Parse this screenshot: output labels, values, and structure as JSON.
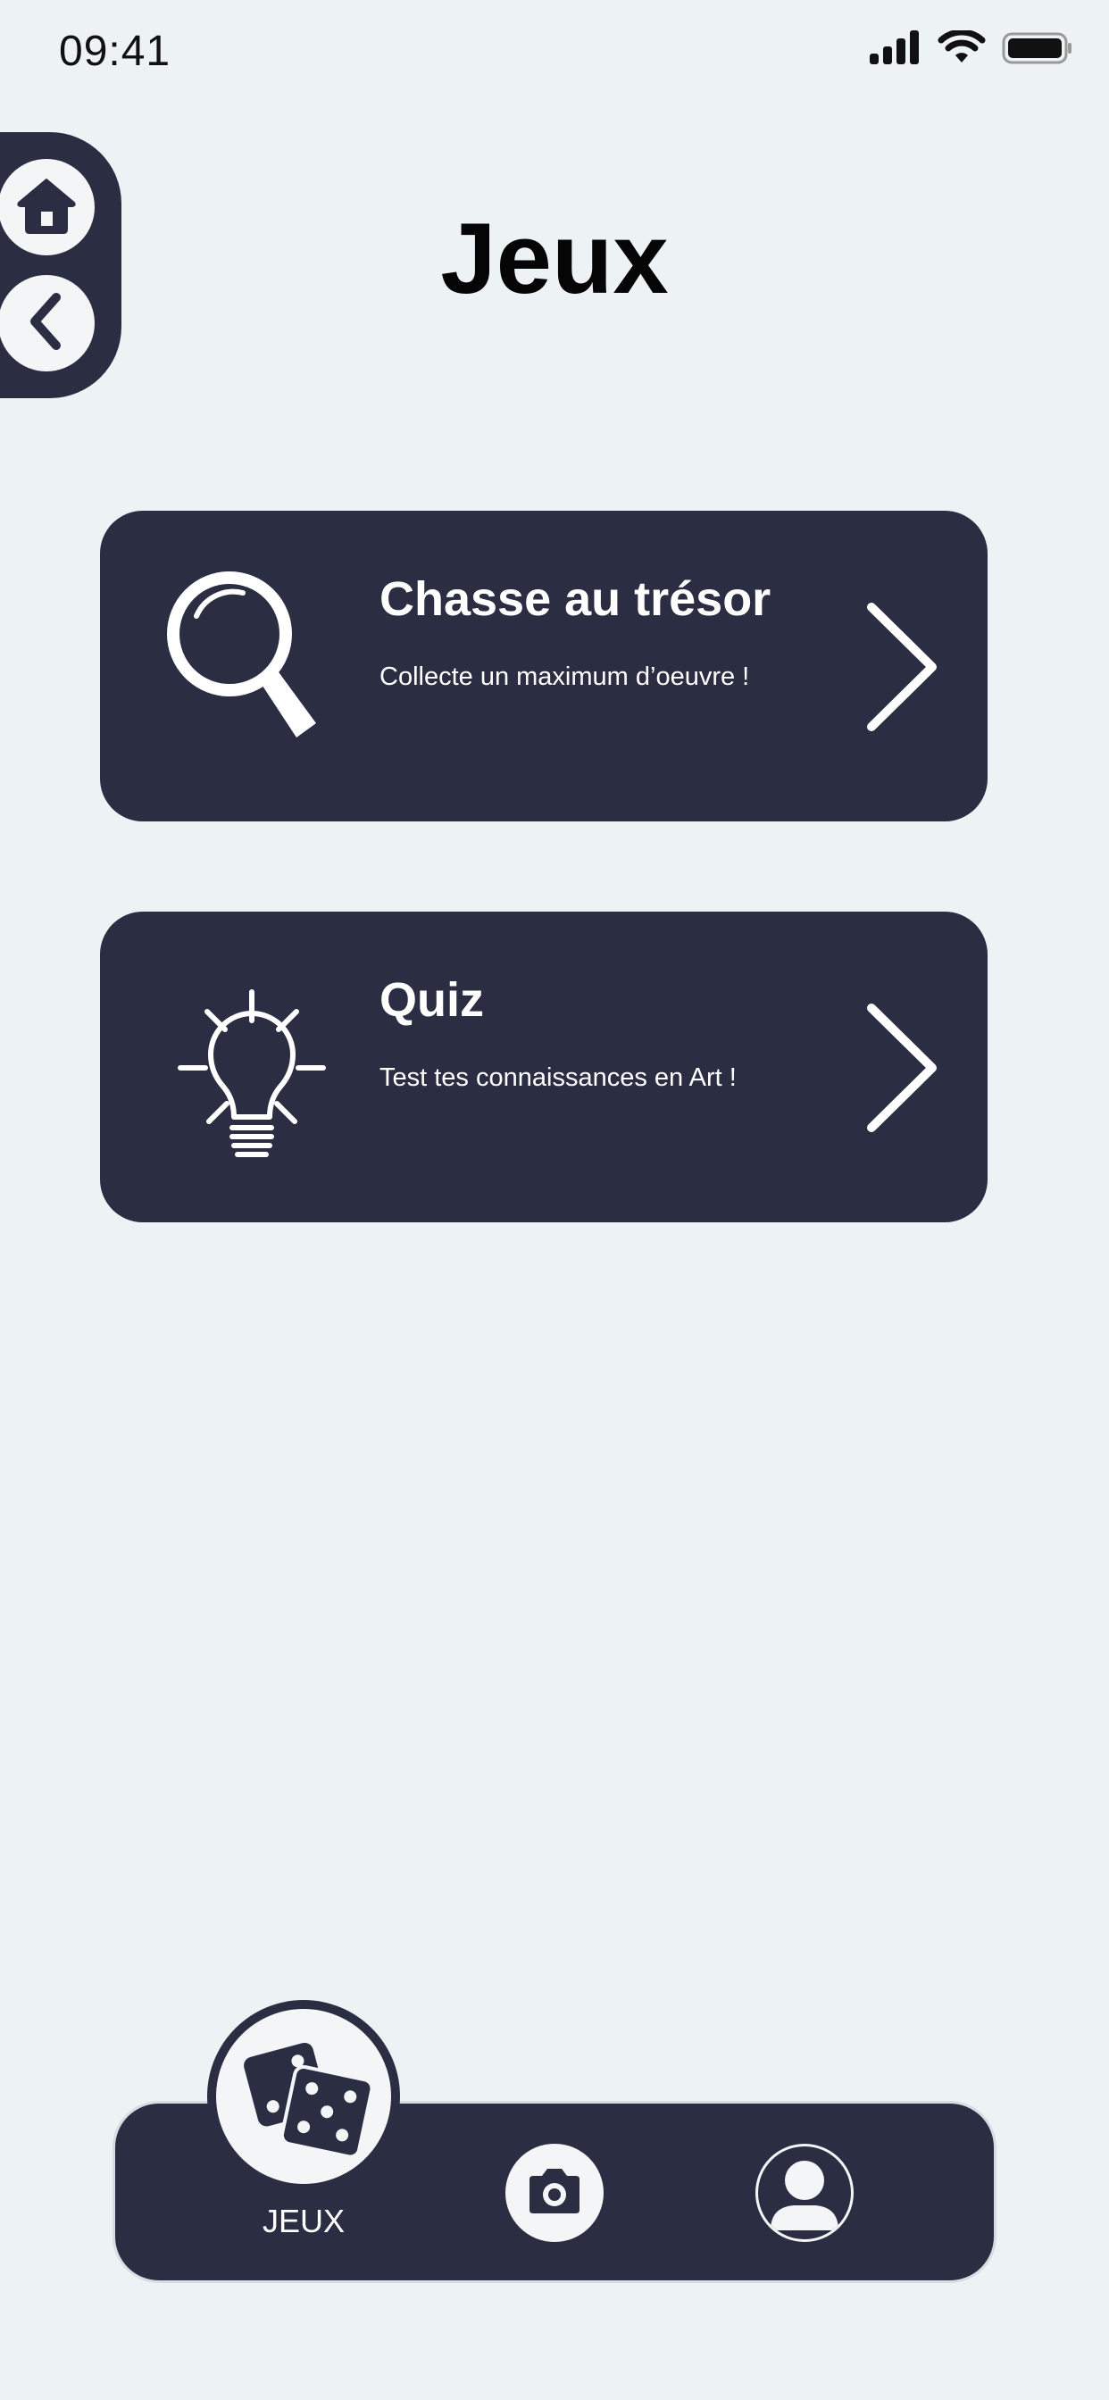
{
  "status_bar": {
    "time": "09:41"
  },
  "icons": {
    "signal": "cellular-signal-icon",
    "wifi": "wifi-icon",
    "battery": "battery-icon",
    "home": "home-icon",
    "back": "chevron-left-icon",
    "magnifier": "magnifying-glass-icon",
    "bulb": "lightbulb-icon",
    "chevron": "chevron-right-icon",
    "dice": "dice-icon",
    "camera": "camera-icon",
    "profile": "user-profile-icon"
  },
  "colors": {
    "background": "#edf2f5",
    "primary_dark": "#2b2e43",
    "light": "#f3f5f7"
  },
  "page": {
    "title": "Jeux"
  },
  "games": [
    {
      "title": "Chasse au trésor",
      "subtitle": "Collecte un maximum d’oeuvre !"
    },
    {
      "title": "Quiz",
      "subtitle": "Test tes connaissances en Art !"
    }
  ],
  "bottom_nav": {
    "items": [
      {
        "label": "JEUX"
      }
    ]
  }
}
